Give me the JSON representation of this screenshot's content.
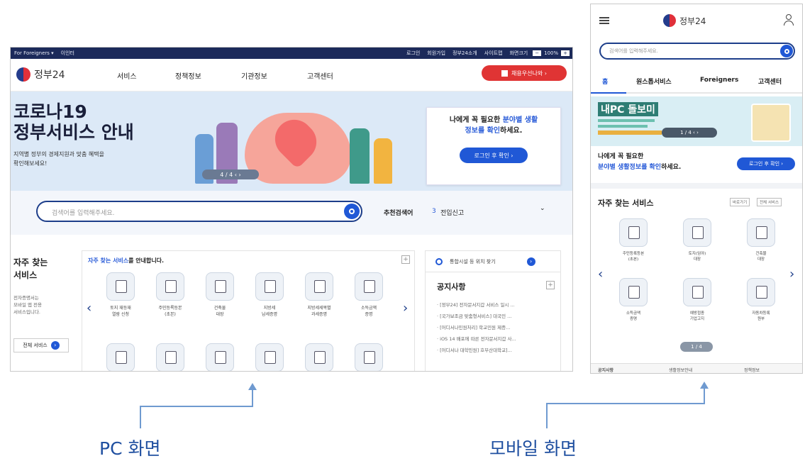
{
  "pc": {
    "topbar": {
      "left": [
        "For Foreigners ▾",
        "이인터"
      ],
      "right": [
        "로그인",
        "회원가입",
        "정부24소개",
        "사이트맵",
        "화면크기",
        "100%"
      ]
    },
    "logo": "정부24",
    "nav": [
      "서비스",
      "정책정보",
      "기관정보",
      "고객센터"
    ],
    "nav_button": "채용우선나와 ›",
    "hero": {
      "title_line1": "코로나19",
      "title_line2": "정부서비스 안내",
      "subtitle_line1": "지역별 정부의 경제지원과 맞춤 혜택을",
      "subtitle_line2": "확인해보세요!",
      "pager": "4 / 4  ‹  ›"
    },
    "hero_card": {
      "line1_a": "나에게 꼭 필요한 ",
      "line1_b": "분야별 생활",
      "line2_a": "정보를 확인",
      "line2_b": "하세요.",
      "button": "로그인 후 확인 ›"
    },
    "search": {
      "placeholder": "검색어를 입력해주세요.",
      "rec_label": "추천검색어",
      "rec_num": "3",
      "rec_value": "전입신고",
      "chevron": "⌄"
    },
    "left_block": {
      "title_line1": "자주 찾는",
      "title_line2": "서비스",
      "desc": [
        "전자증명서는",
        "모바일 앱 전용",
        "서비스입니다."
      ],
      "button": "전체 서비스"
    },
    "svc_header_a": "자주 찾는 서비스",
    "svc_header_b": "를 안내합니다.",
    "services_row1": [
      {
        "label1": "토지 재등재",
        "label2": "열람 신청"
      },
      {
        "label1": "주민등록등본",
        "label2": "(초본)"
      },
      {
        "label1": "건축물",
        "label2": "대장"
      },
      {
        "label1": "지방세",
        "label2": "납세증명"
      },
      {
        "label1": "지방세세목별",
        "label2": "과세증명"
      },
      {
        "label1": "소득금액",
        "label2": "증명"
      }
    ],
    "locator": "통합시설 등 위치 찾기",
    "notice_title": "공지사항",
    "notices": [
      "· [정부24] 전자문서지갑 서비스 일시 ...",
      "· [국가보조금 맞춤형서비스] 대국민 ...",
      "· [어디서나민원처리] 학교민원 제증...",
      "· iOS 14 배포에 따른 전자문서지갑 사...",
      "· [어디서나 대학민원] 호부산대학교]..."
    ]
  },
  "mobile": {
    "logo": "정부24",
    "search_placeholder": "검색어를 입력해주세요.",
    "tabs": [
      "홈",
      "원스톱서비스",
      "Foreigners",
      "고객센터"
    ],
    "banner_title": "내PC 돌보미",
    "banner_pager": "1 / 4  ‹  ›",
    "info_line1": "나에게 꼭 필요한",
    "info_line2_a": "분야별 생활정보를 확인",
    "info_line2_b": "하세요.",
    "info_button": "로그인 후 확인 ›",
    "svc_title": "자주 찾는 서비스",
    "svc_toggle": [
      "바로가기",
      "전체 서비스"
    ],
    "services": [
      {
        "label1": "주민등록등본",
        "label2": "(초본)"
      },
      {
        "label1": "토지(임야)",
        "label2": "대장"
      },
      {
        "label1": "건축물",
        "label2": "대장"
      },
      {
        "label1": "소득금액",
        "label2": "증명"
      },
      {
        "label1": "예방접종",
        "label2": "기업고지"
      },
      {
        "label1": "자동차등록",
        "label2": "원부"
      }
    ],
    "pager": "1 / 4",
    "bottom_tabs": [
      "공지사항",
      "생활정보안내",
      "정책정보"
    ]
  },
  "captions": {
    "pc": "PC 화면",
    "mobile": "모바일 화면"
  }
}
